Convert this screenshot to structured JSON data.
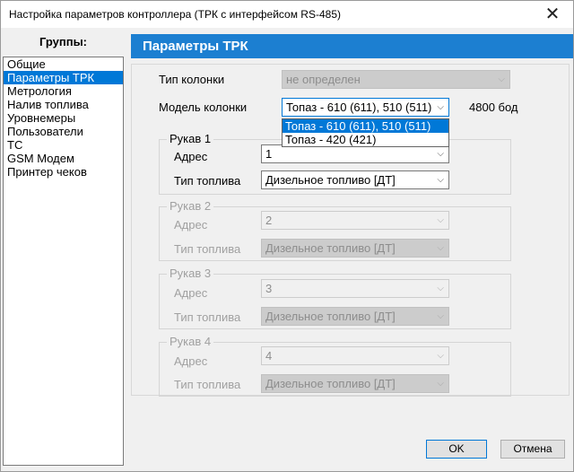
{
  "window": {
    "title": "Настройка параметров контроллера (ТРК с интерфейсом RS-485)",
    "close_glyph": "✕"
  },
  "groups": {
    "header": "Группы:",
    "items": [
      {
        "label": "Общие",
        "selected": false
      },
      {
        "label": "Параметры ТРК",
        "selected": true
      },
      {
        "label": "Метрология",
        "selected": false
      },
      {
        "label": "Налив топлива",
        "selected": false
      },
      {
        "label": "Уровнемеры",
        "selected": false
      },
      {
        "label": "Пользователи",
        "selected": false
      },
      {
        "label": "ТС",
        "selected": false
      },
      {
        "label": "GSM Модем",
        "selected": false
      },
      {
        "label": "Принтер чеков",
        "selected": false
      }
    ]
  },
  "panel": {
    "title": "Параметры ТРК",
    "pump_type": {
      "label": "Тип колонки",
      "value": "не определен"
    },
    "pump_model": {
      "label": "Модель колонки",
      "value": "Топаз - 610 (611), 510 (511)",
      "baud": "4800 бод",
      "options": [
        {
          "label": "Топаз - 610 (611), 510 (511)",
          "selected": true
        },
        {
          "label": "Топаз - 420 (421)",
          "selected": false
        }
      ]
    },
    "hoses": [
      {
        "title": "Рукав 1",
        "address_label": "Адрес",
        "address": "1",
        "fuel_label": "Тип топлива",
        "fuel": "Дизельное топливо [ДТ]",
        "enabled": true
      },
      {
        "title": "Рукав 2",
        "address_label": "Адрес",
        "address": "2",
        "fuel_label": "Тип топлива",
        "fuel": "Дизельное топливо [ДТ]",
        "enabled": false
      },
      {
        "title": "Рукав 3",
        "address_label": "Адрес",
        "address": "3",
        "fuel_label": "Тип топлива",
        "fuel": "Дизельное топливо [ДТ]",
        "enabled": false
      },
      {
        "title": "Рукав 4",
        "address_label": "Адрес",
        "address": "4",
        "fuel_label": "Тип топлива",
        "fuel": "Дизельное топливо [ДТ]",
        "enabled": false
      }
    ]
  },
  "buttons": {
    "ok": "OK",
    "cancel": "Отмена"
  },
  "icons": {
    "dropdown_arrow": "chevron-down-icon",
    "arrow_glyph": "⌵"
  },
  "colors": {
    "accent": "#0078d7",
    "header_bg": "#1c7fd1"
  }
}
